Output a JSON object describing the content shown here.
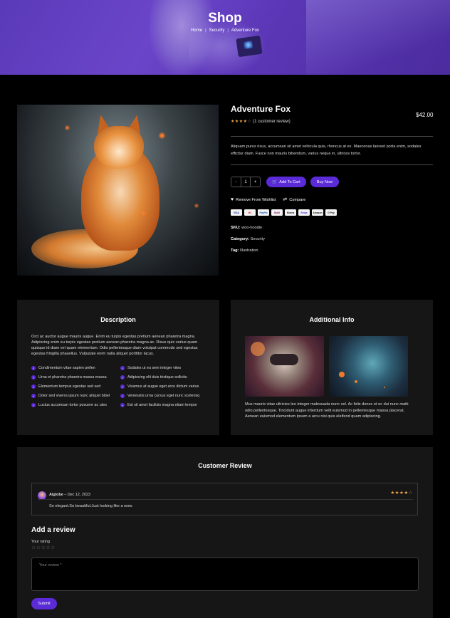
{
  "hero": {
    "title": "Shop",
    "breadcrumbs": [
      "Home",
      "Security",
      "Adventure Fox"
    ]
  },
  "product": {
    "name": "Adventure Fox",
    "price": "$42.00",
    "rating": 4,
    "rating_text": "(1 customer review)",
    "description": "Aliquam purus risus, accumsan sit amet vehicula quis, rhoncus at ex. Maecenas laoreet porta enim, sodales efficitur diam. Fusce non mauris bibendum, varius neque in, ultrices tortor.",
    "quantity": "1",
    "qty_minus": "-",
    "qty_plus": "+",
    "add_to_cart_label": "Add To Cart",
    "buy_now_label": "Buy Now",
    "wishlist_label": "Remove From Wishlist",
    "compare_label": "Compare",
    "payment_methods": [
      "VISA",
      "MC",
      "PayPal",
      "Skrill",
      "Klarna",
      "Stripe",
      "Amazon",
      "G Pay"
    ],
    "sku_label": "SKU:",
    "sku": "woo-hoodie",
    "category_label": "Category:",
    "category": "Security",
    "tag_label": "Tag:",
    "tag": "Illustration"
  },
  "description_panel": {
    "title": "Description",
    "text": "Orci ac auctor augue mauris augue. Enim eu turpis egestas pretium aenean pharetra magna. Adipiscing enim eu turpis egestas pretium aenean pharetra magna ac. Risus quis varius quam quisque id diam vel quam elementum. Odio pellentesque diam volutpat commodo sed egestas egestas fringilla phasellus. Vulputate enim nulla aliquet porttitor lacus.",
    "features_left": [
      "Condimentum vitae sapien pellen",
      "Urna et pharetra pharetra massa massa",
      "Elementum tempus egestas sed sed",
      "Dolor sed viverra ipsum nunc aliquet bibel",
      "Luctus accumsan tortor posuere ac utes"
    ],
    "features_right": [
      "Sodales ut eu sem integer vites",
      "Adipiscing elit duis tristique sollicitu",
      "Vivamus at augue eget arcu dictum varius",
      "Venenatis urna cursus eget nunc scelerisq",
      "Est sit amet facilisis magna etiam tempor"
    ]
  },
  "info_panel": {
    "title": "Additional Info",
    "text": "Mus mauris vitae ultricies leo integer malesuada nunc vel. Ac felis donec et oc dui nunc matti odio pellentesque. Tincidunt augue interdum velit euismod in pellentesque massa placerat. Aenean euismod elementum ipsum a arcu nisi quis eleifend quam adipiscing."
  },
  "reviews": {
    "title": "Customer Review",
    "items": [
      {
        "author": "Aiglobe",
        "date": "– Dec 12, 2023",
        "rating": 4,
        "body": "So elegant.So beautiful.Just looking like a wow."
      }
    ],
    "add_title": "Add a review",
    "rating_label": "Your rating",
    "review_placeholder": "Your review *",
    "submit_label": "Submit"
  },
  "colors": {
    "accent": "#5b2bd8",
    "star": "#f0a64a",
    "panel": "#161616"
  }
}
